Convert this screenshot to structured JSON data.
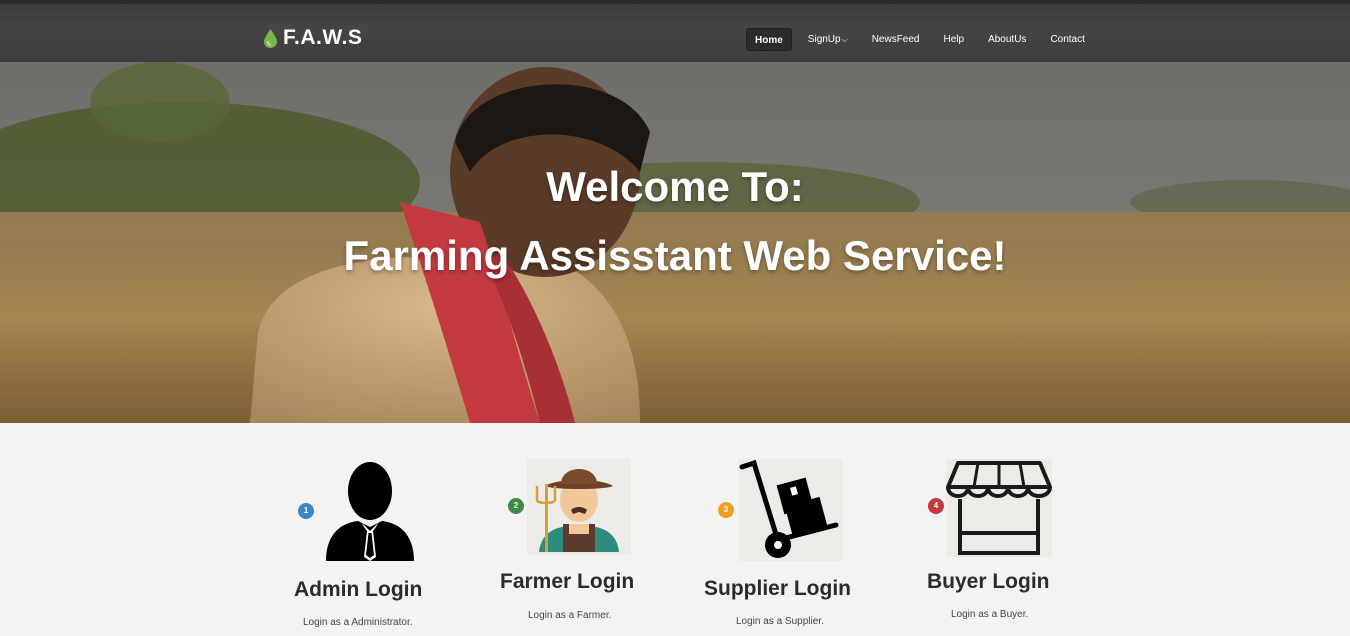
{
  "brand": {
    "name": "F.A.W.S",
    "icon": "leaf-drop-icon",
    "accent": "#7ab648"
  },
  "nav": [
    {
      "label": "Home",
      "active": true
    },
    {
      "label": "SignUp",
      "dropdown": true
    },
    {
      "label": "NewsFeed"
    },
    {
      "label": "Help"
    },
    {
      "label": "AboutUs"
    },
    {
      "label": "Contact"
    }
  ],
  "hero": {
    "line1": "Welcome To:",
    "line2": "Farming Assisstant Web Service!"
  },
  "cards": [
    {
      "number": "1",
      "title": "Admin Login",
      "desc": "Login as a Administrator.",
      "icon": "admin-person-icon",
      "badge_color": "#3b86c4"
    },
    {
      "number": "2",
      "title": "Farmer Login",
      "desc": "Login as a Farmer.",
      "icon": "farmer-icon",
      "badge_color": "#3e8a47"
    },
    {
      "number": "3",
      "title": "Supplier Login",
      "desc": "Login as a Supplier.",
      "icon": "hand-truck-icon",
      "badge_color": "#f0a020"
    },
    {
      "number": "4",
      "title": "Buyer Login",
      "desc": "Login as a Buyer.",
      "icon": "market-stall-icon",
      "badge_color": "#c0393b"
    }
  ]
}
